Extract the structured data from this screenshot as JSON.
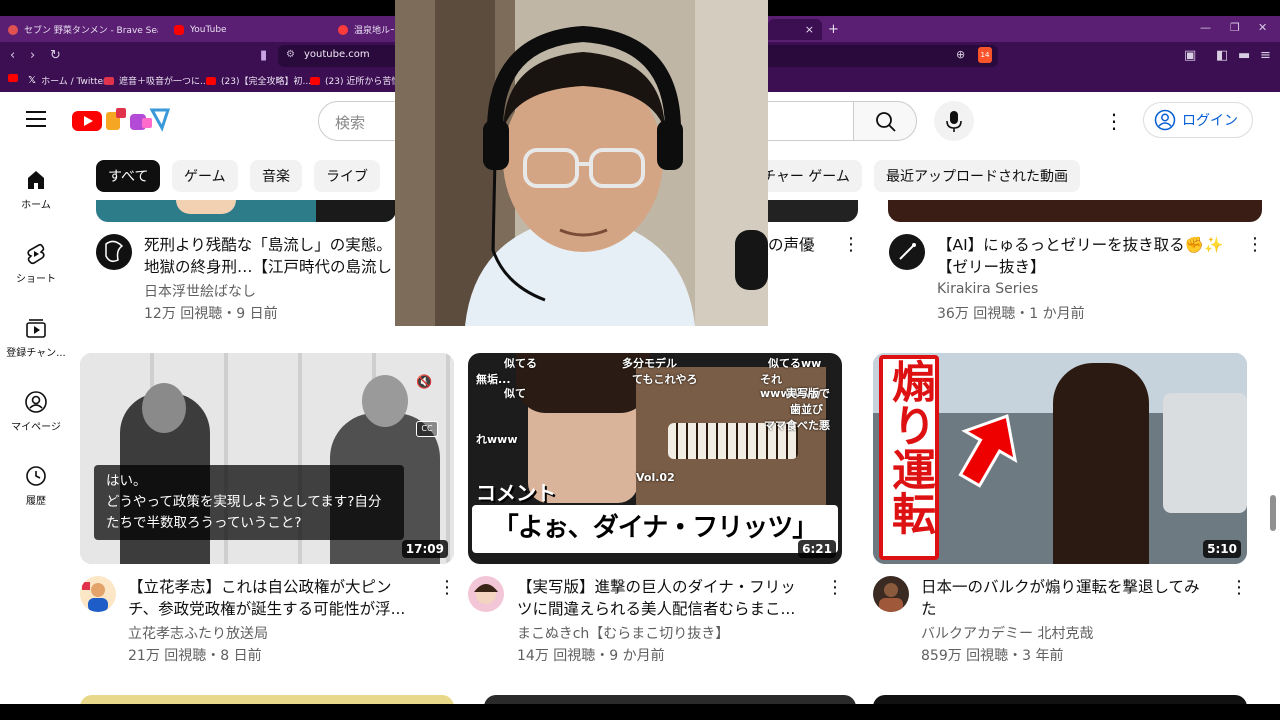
{
  "browser": {
    "tabs": [
      {
        "label": "セブン 野菜タンメン - Brave Search",
        "color": "#e05252"
      },
      {
        "label": "YouTube",
        "color": "#ff0000"
      },
      {
        "label": "温泉地ルール",
        "color": "#ff3b3b"
      }
    ],
    "close_tab": "×",
    "new_tab": "+",
    "url": "youtube.com",
    "shield_count": "14",
    "bookmarks": [
      {
        "label": "",
        "color": "#ff0000"
      },
      {
        "label": "ホーム / Twitter",
        "color": "#222222"
      },
      {
        "label": "遮音＋吸音が一つに...",
        "color": "#e0334b"
      },
      {
        "label": "(23)【完全攻略】初...",
        "color": "#ff0000"
      },
      {
        "label": "(23) 近所から苦情が...",
        "color": "#ff0000"
      }
    ]
  },
  "youtube": {
    "search_placeholder": "検索",
    "login_label": "ログイン",
    "chips": [
      "すべて",
      "ゲーム",
      "音楽",
      "ライブ",
      "チャー ゲーム",
      "最近アップロードされた動画"
    ],
    "sidebar": [
      {
        "label": "ホーム",
        "icon": "home-icon"
      },
      {
        "label": "ショート",
        "icon": "shorts-icon"
      },
      {
        "label": "登録チャン...",
        "icon": "subscriptions-icon"
      },
      {
        "label": "マイページ",
        "icon": "profile-icon"
      },
      {
        "label": "履歴",
        "icon": "history-icon"
      }
    ],
    "row1": [
      {
        "title_line1": "死刑より残酷な「島流し」の実態。",
        "title_line2": "地獄の終身刑…【江戸時代の島流し",
        "channel": "日本浮世絵ばなし",
        "meta": "12万 回視聴・9 日前"
      },
      {
        "title_line1": "の声優",
        "title_line2": ""
      },
      {
        "title_line1": "【AI】にゅるっとゼリーを抜き取る✊✨",
        "title_line2": "【ゼリー抜き】",
        "channel": "Kirakira Series",
        "meta": "36万 回視聴・1 か月前"
      }
    ],
    "row2": [
      {
        "title_line1": "【立花孝志】これは自公政権が大ピン",
        "title_line2": "チ、参政党政権が誕生する可能性が浮...",
        "channel": "立花孝志ふたり放送局",
        "meta": "21万 回視聴・8 日前",
        "duration": "17:09",
        "caption_line1": "はい。",
        "caption_line2": "どうやって政策を実現しようとしてます?自分",
        "caption_line3": "たちで半数取ろうっていうこと?",
        "cc": "CC"
      },
      {
        "title_line1": "【実写版】進撃の巨人のダイナ・フリッ",
        "title_line2": "ツに間違えられる美人配信者むらまこ...",
        "channel": "まこぬきch【むらまこ切り抜き】",
        "meta": "14万 回視聴・9 か月前",
        "duration": "6:21",
        "thumb_big": "「よぉ、ダイナ・フリッツ」",
        "thumb_label": "コメント",
        "thumb_comments": [
          "似てる",
          "多分モデル",
          "似てるww",
          "無垢...",
          "てもこれやろ",
          "それwwwwww",
          "似て",
          "実写版で",
          "れwww",
          "歯並び",
          "ママ食べた悪",
          "Vol.02"
        ]
      },
      {
        "title_line1": "日本一のバルクが煽り運転を撃退してみ",
        "title_line2": "た",
        "channel": "バルクアカデミー 北村克哉",
        "meta": "859万 回視聴・3 年前",
        "duration": "5:10",
        "thumb_text": "煽り運転"
      }
    ]
  },
  "colors": {
    "brand_red": "#ff0000",
    "browser_purple": "#3b0f52",
    "link_blue": "#065fd4",
    "meta_gray": "#606060"
  }
}
